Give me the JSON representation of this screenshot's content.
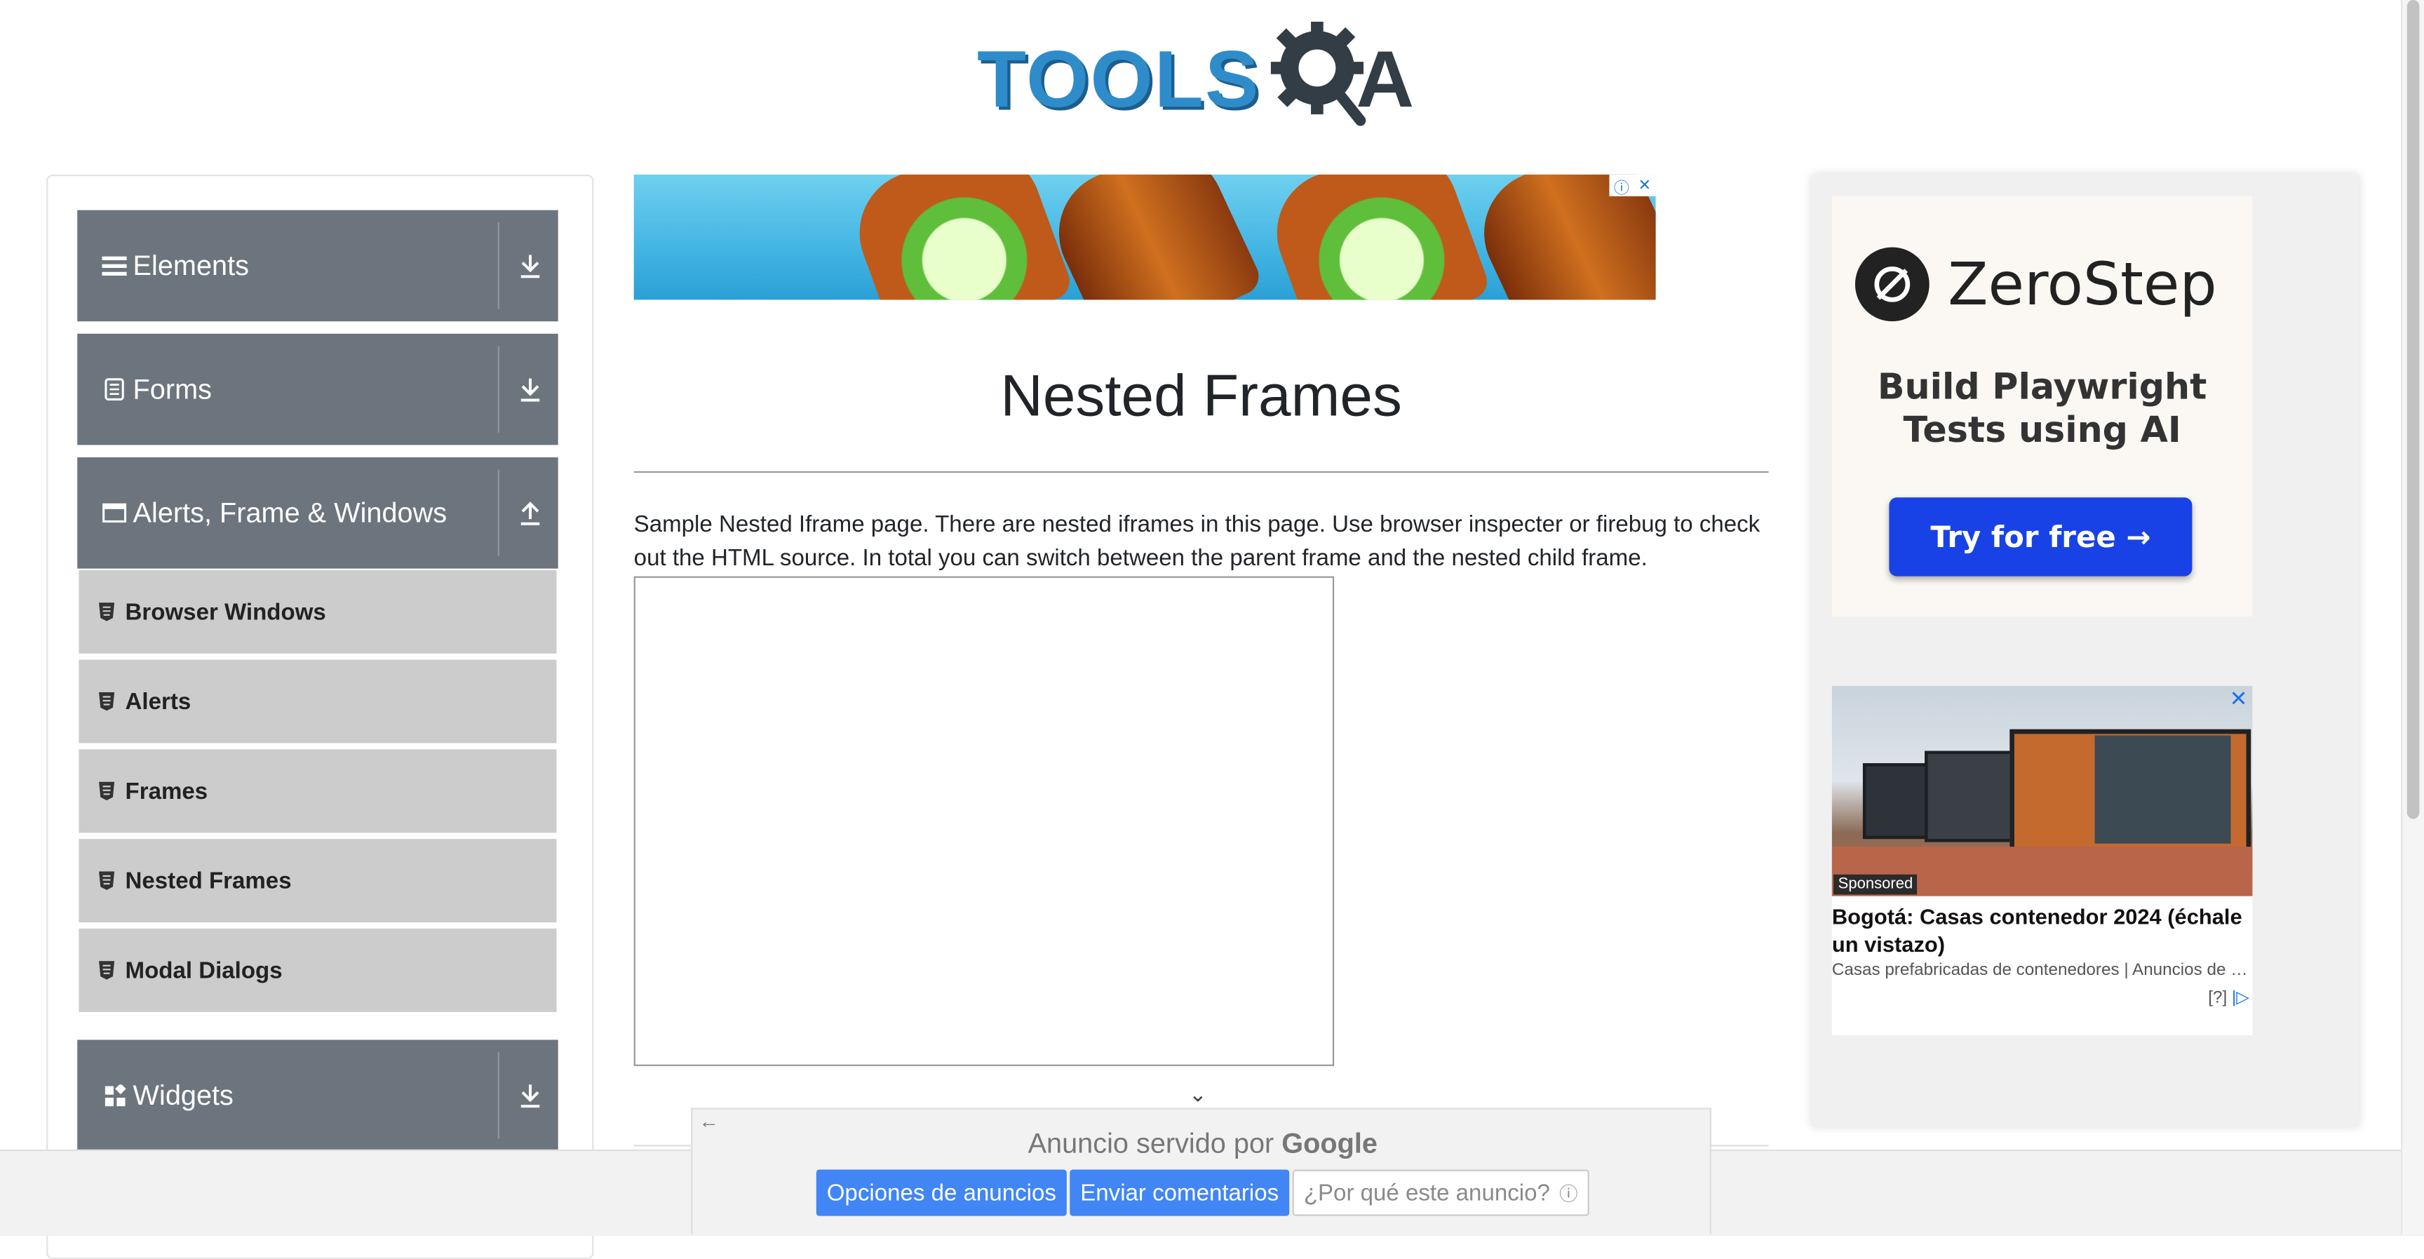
{
  "header": {
    "logo_text_main": "TOOLS",
    "logo_text_suffix": "A"
  },
  "sidebar": {
    "groups": [
      {
        "label": "Elements",
        "icon": "hamburger-icon",
        "arrow": "download-arrow-icon"
      },
      {
        "label": "Forms",
        "icon": "document-icon",
        "arrow": "download-arrow-icon"
      },
      {
        "label": "Alerts, Frame & Windows",
        "icon": "window-icon",
        "arrow": "upload-arrow-icon"
      },
      {
        "label": "Widgets",
        "icon": "widgets-icon",
        "arrow": "download-arrow-icon"
      }
    ],
    "items": [
      {
        "label": "Browser Windows"
      },
      {
        "label": "Alerts"
      },
      {
        "label": "Frames"
      },
      {
        "label": "Nested Frames"
      },
      {
        "label": "Modal Dialogs"
      }
    ]
  },
  "main": {
    "title": "Nested Frames",
    "description": "Sample Nested Iframe page. There are nested iframes in this page. Use browser inspecter or firebug to check out the HTML source. In total you can switch between the parent frame and the nested child frame."
  },
  "right_ad": {
    "brand": "ZeroStep",
    "headline_line1": "Build Playwright",
    "headline_line2": "Tests using AI",
    "cta": "Try for free →",
    "sponsored_badge": "Sponsored",
    "sponsored_title": "Bogotá: Casas contenedor 2024 (échale un vistazo)",
    "sponsored_source": "Casas prefabricadas de contenedores | Anuncios de b...",
    "sponsored_footer": "[?]",
    "close_symbol": "✕"
  },
  "top_ad": {
    "choices_info": "ⓘ",
    "choices_close": "✕"
  },
  "google_ad_bar": {
    "served_prefix": "Anuncio servido por",
    "served_brand": "Google",
    "options_button": "Opciones de anuncios",
    "feedback_button": "Enviar comentarios",
    "why_button": "¿Por qué este anuncio?",
    "back_arrow": "←",
    "collapse_chevron": "⌄"
  },
  "colors": {
    "sidebar_group_bg": "#6c757d",
    "sidebar_item_bg": "#cccccc",
    "logo_blue": "#2f8ccb",
    "cta_blue": "#1842e5",
    "google_button_blue": "#4285f4"
  }
}
